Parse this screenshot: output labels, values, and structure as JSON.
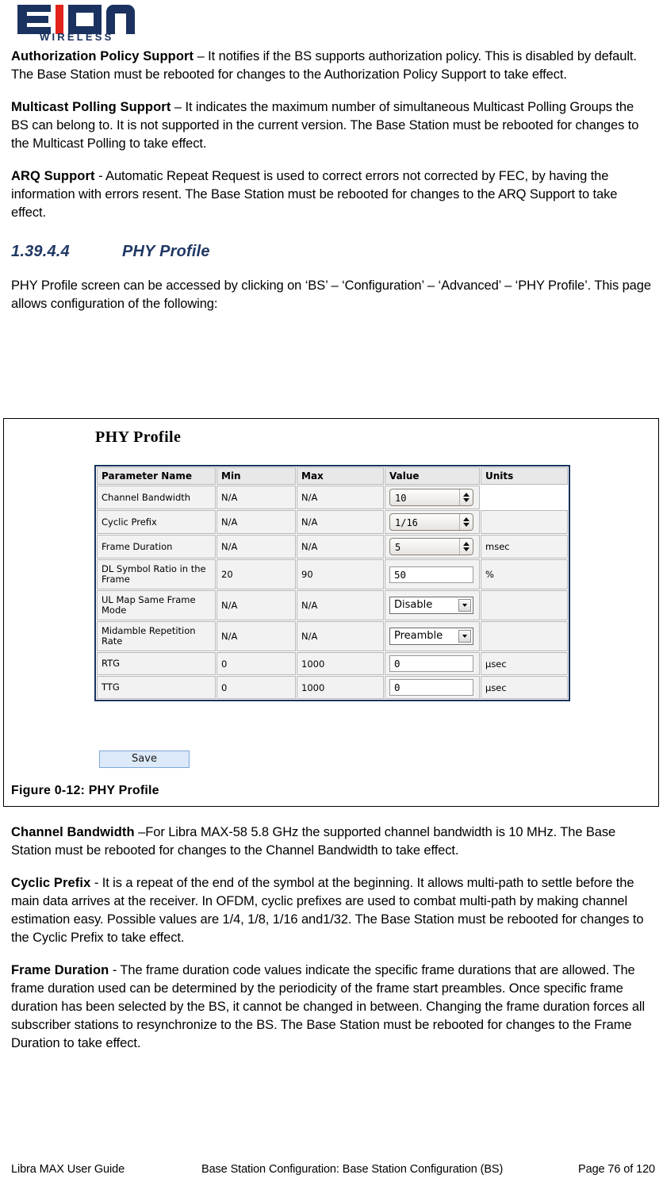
{
  "logo": {
    "brand": "EION",
    "tagline": "WIRELESS",
    "navy": "#1b3260",
    "red": "#e2231a"
  },
  "body": {
    "paragraphs": [
      {
        "term": "Authorization Policy Support",
        "text": " – It notifies if the BS supports authorization policy. This is disabled by default. The Base Station must be rebooted for changes to the Authorization Policy Support to take effect."
      },
      {
        "term": "Multicast Polling Support",
        "text": " – It indicates the maximum number of simultaneous Multicast Polling Groups the BS can belong to. It is not supported in the current version. The Base Station must be rebooted for changes to the Multicast Polling to take effect."
      },
      {
        "term": "ARQ Support",
        "text": " - Automatic Repeat Request is used to correct errors not corrected by FEC, by having the information with errors resent. The Base Station must be rebooted for changes to the ARQ Support to take effect."
      }
    ],
    "heading": {
      "number": "1.39.4.4",
      "title": "PHY Profile",
      "color": "#1F3864"
    },
    "intro": "PHY Profile screen can be accessed by clicking on ‘BS’ – ‘Configuration’ – ‘Advanced’ – ‘PHY Profile’. This page allows configuration of the following:"
  },
  "figure": {
    "caption": "Figure 0-12: PHY Profile",
    "screenshot": {
      "title": "PHY Profile",
      "save_label": "Save",
      "columns": [
        "Parameter Name",
        "Min",
        "Max",
        "Value",
        "Units"
      ],
      "rows": [
        {
          "name": "Channel Bandwidth",
          "min": "N/A",
          "max": "N/A",
          "control": "spinner",
          "value": "10",
          "units": ""
        },
        {
          "name": "Cyclic Prefix",
          "min": "N/A",
          "max": "N/A",
          "control": "spinner",
          "value": "1/16",
          "units": ""
        },
        {
          "name": "Frame Duration",
          "min": "N/A",
          "max": "N/A",
          "control": "spinner",
          "value": "5",
          "units": "msec"
        },
        {
          "name": "DL Symbol Ratio in the Frame",
          "min": "20",
          "max": "90",
          "control": "text",
          "value": "50",
          "units": "%"
        },
        {
          "name": "UL Map Same Frame Mode",
          "min": "N/A",
          "max": "N/A",
          "control": "select",
          "value": "Disable",
          "units": ""
        },
        {
          "name": "Midamble Repetition Rate",
          "min": "N/A",
          "max": "N/A",
          "control": "select",
          "value": "Preamble",
          "units": ""
        },
        {
          "name": "RTG",
          "min": "0",
          "max": "1000",
          "control": "text",
          "value": "0",
          "units": "µsec"
        },
        {
          "name": "TTG",
          "min": "0",
          "max": "1000",
          "control": "text",
          "value": "0",
          "units": "µsec"
        }
      ]
    }
  },
  "body_lower": {
    "paragraphs": [
      {
        "term": "Channel Bandwidth",
        "text": " –For Libra MAX-58 5.8 GHz the supported channel bandwidth is 10 MHz. The Base Station must be rebooted for changes to the Channel Bandwidth to take effect."
      },
      {
        "term": "Cyclic Prefix",
        "text": " - It is a repeat of the end of the symbol at the beginning. It allows multi-path to settle before the main data arrives at the receiver. In OFDM, cyclic prefixes are used to combat multi-path by making channel estimation easy. Possible values are 1/4, 1/8, 1/16 and1/32. The Base Station must be rebooted for changes to the Cyclic Prefix to take effect."
      },
      {
        "term": "Frame Duration",
        "text": " - The frame duration code values indicate the specific frame durations that are allowed. The frame duration used can be determined by the periodicity of the frame start preambles. Once specific frame duration has been selected by the BS, it cannot be changed in between. Changing the frame duration forces all subscriber stations to resynchronize to the BS. The Base Station must be rebooted for changes to the Frame Duration to take effect."
      }
    ]
  },
  "footer": {
    "left": "Libra MAX User Guide",
    "middle": "Base Station Configuration: Base Station Configuration (BS)",
    "right": "Page 76 of 120"
  }
}
